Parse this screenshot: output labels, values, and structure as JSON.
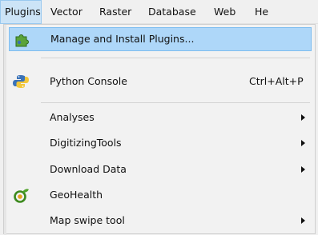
{
  "menubar": {
    "items": [
      "Plugins",
      "Vector",
      "Raster",
      "Database",
      "Web",
      "He"
    ]
  },
  "plugins_menu": {
    "manage": {
      "label": "Manage and Install Plugins...",
      "icon": "puzzle-plugin-icon"
    },
    "python": {
      "label": "Python Console",
      "shortcut": "Ctrl+Alt+P",
      "icon": "python-icon"
    },
    "analyses": {
      "label": "Analyses"
    },
    "digitizing": {
      "label": "DigitizingTools"
    },
    "download": {
      "label": "Download Data"
    },
    "geohealth": {
      "label": "GeoHealth",
      "icon": "geohealth-icon"
    },
    "mapswipe": {
      "label": "Map swipe tool"
    }
  },
  "colors": {
    "highlight": "#aed7f9",
    "menubar_active": "#cce4f7"
  }
}
